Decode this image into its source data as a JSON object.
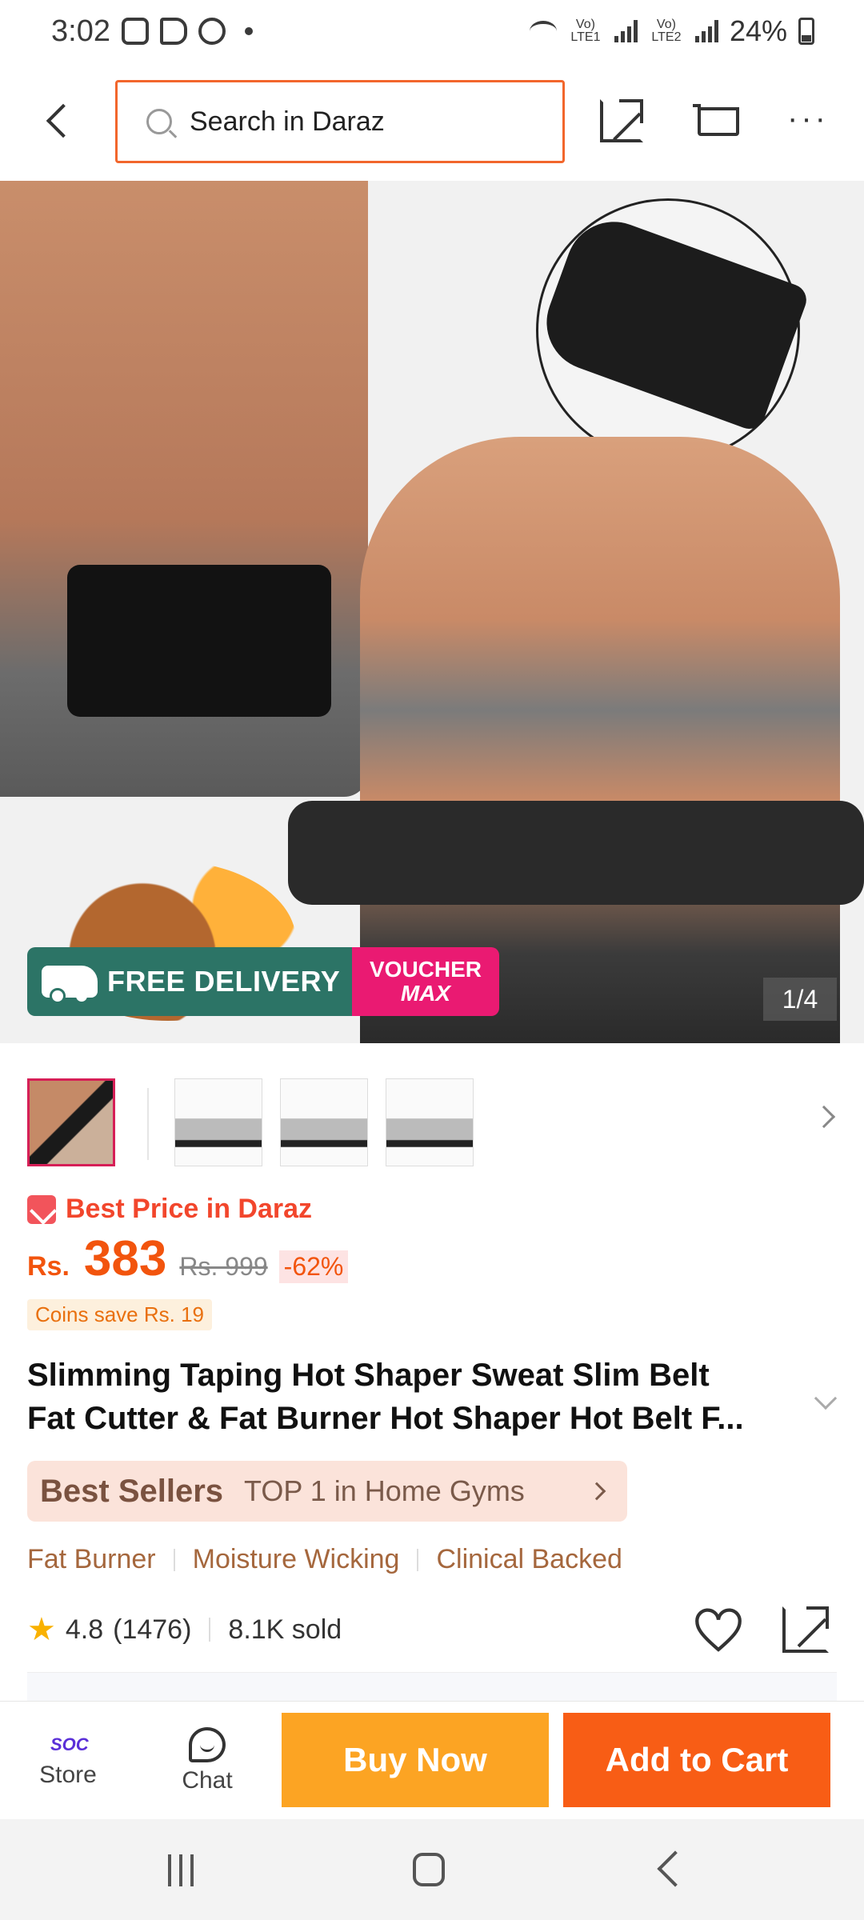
{
  "status_bar": {
    "time": "3:02",
    "sim1": "Vo) LTE1",
    "sim2": "Vo) LTE2",
    "battery": "24%"
  },
  "header": {
    "search_placeholder": "Search in Daraz",
    "icons": [
      "back-icon",
      "search-icon",
      "share-icon",
      "cart-icon",
      "more-icon"
    ]
  },
  "gallery": {
    "promo_free_delivery": "FREE DELIVERY",
    "promo_voucher_1": "VOUCHER",
    "promo_voucher_2": "MAX",
    "counter": "1/4",
    "thumbnails": [
      "main",
      "small-size-chart",
      "medium-size-chart",
      "large-size-chart"
    ]
  },
  "price": {
    "badge": "Best Price in Daraz",
    "currency": "Rs.",
    "current": "383",
    "original": "Rs. 999",
    "discount": "-62%",
    "coins": "Coins save Rs. 19"
  },
  "product": {
    "title_line1": "Slimming Taping Hot Shaper Sweat Slim Belt",
    "title_line2": "Fat Cutter & Fat Burner Hot Shaper Hot Belt F..."
  },
  "best_sellers": {
    "label": "Best Sellers",
    "rank": "TOP 1 in Home Gyms"
  },
  "features": [
    "Fat Burner",
    "Moisture Wicking",
    "Clinical Backed"
  ],
  "rating": {
    "score": "4.8",
    "count": "(1476)",
    "sold": "8.1K sold"
  },
  "bottom_bar": {
    "store_label": "Store",
    "store_logo": "SOC",
    "chat_label": "Chat",
    "buy_now": "Buy Now",
    "add_to_cart": "Add to Cart"
  },
  "colors": {
    "accent_orange": "#f85d15",
    "buy_now_yellow": "#fca423",
    "search_border": "#f2662c",
    "promo_green": "#2c7466",
    "promo_pink": "#ea1a72"
  }
}
